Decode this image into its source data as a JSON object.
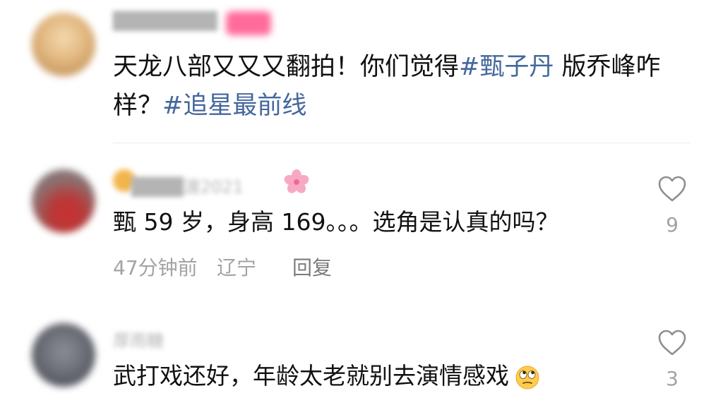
{
  "post": {
    "username": "████████",
    "text_before": "天龙八部又又又翻拍！你们觉得",
    "hashtag_1": "#甄子丹",
    "text_middle": " 版乔峰咋样？",
    "hashtag_2": "#追星最前线"
  },
  "comments": [
    {
      "username": "████渡2021",
      "text": "甄 59 岁，身高 169。。。选角是认真的吗？",
      "time": "47分钟前",
      "region": "辽宁",
      "reply_label": "回复",
      "likes": "9",
      "like_icon": "heart-outline-icon",
      "badge_icon": "cherry-blossom-icon"
    },
    {
      "username": "厚雨糖",
      "text": "武打戏还好，年龄太老就别去演情感戏",
      "emoji": "eye-roll-emoji-icon",
      "likes": "3",
      "like_icon": "heart-outline-icon"
    }
  ],
  "colors": {
    "hashtag": "#44679c",
    "text": "#111111",
    "meta": "#a3a3a3",
    "divider": "#ececec"
  }
}
